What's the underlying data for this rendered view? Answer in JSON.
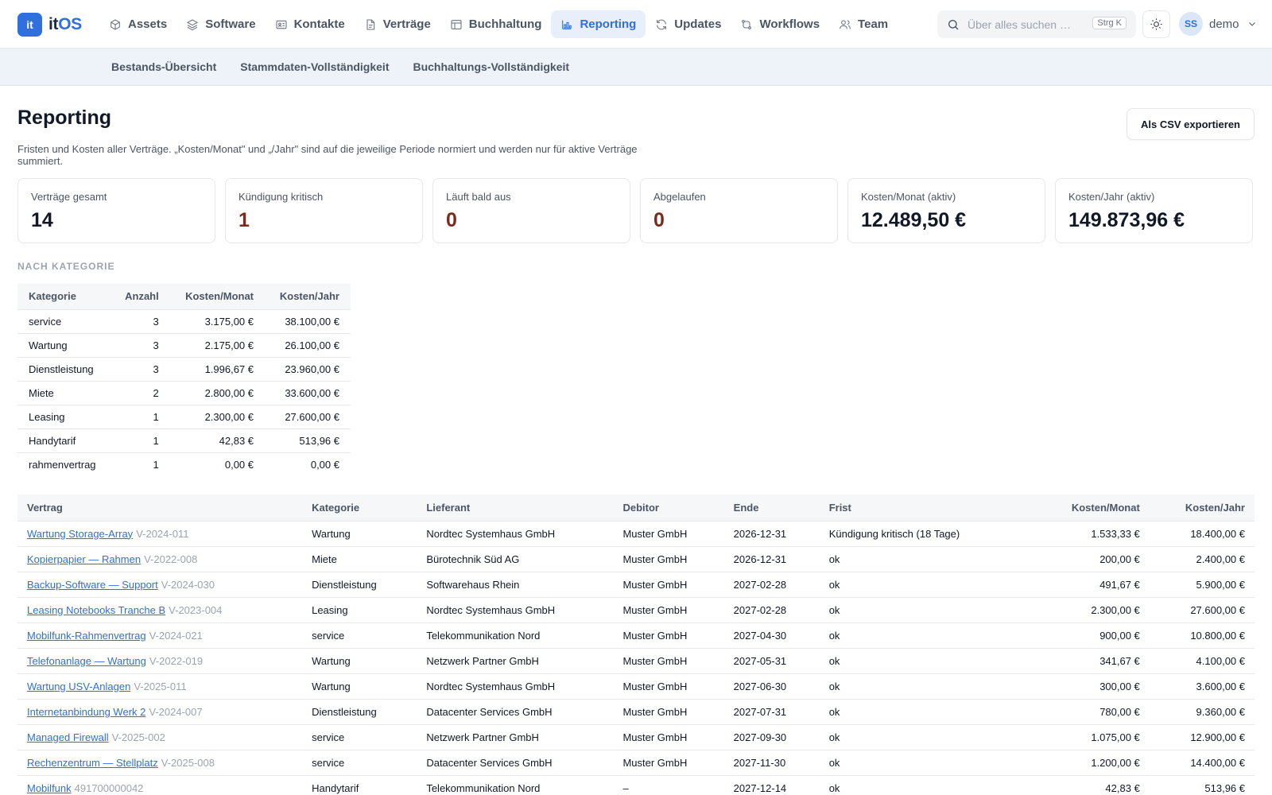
{
  "app": {
    "logo_badge": "it",
    "logo_prefix": "it",
    "logo_suffix": "OS"
  },
  "nav": [
    {
      "label": "Assets",
      "icon": "cube-icon",
      "active": false
    },
    {
      "label": "Software",
      "icon": "layers-icon",
      "active": false
    },
    {
      "label": "Kontakte",
      "icon": "contact-card-icon",
      "active": false
    },
    {
      "label": "Verträge",
      "icon": "document-icon",
      "active": false
    },
    {
      "label": "Buchhaltung",
      "icon": "ledger-icon",
      "active": false
    },
    {
      "label": "Reporting",
      "icon": "bar-chart-icon",
      "active": true
    },
    {
      "label": "Updates",
      "icon": "refresh-icon",
      "active": false
    },
    {
      "label": "Workflows",
      "icon": "workflow-icon",
      "active": false
    },
    {
      "label": "Team",
      "icon": "users-icon",
      "active": false
    }
  ],
  "search": {
    "placeholder": "Über alles suchen …",
    "shortcut": "Strg K"
  },
  "user": {
    "initials": "SS",
    "name": "demo"
  },
  "subnav": [
    "Bestands-Übersicht",
    "Stammdaten-Vollständigkeit",
    "Buchhaltungs-Vollständigkeit"
  ],
  "page": {
    "title": "Reporting",
    "description": "Fristen und Kosten aller Verträge. „Kosten/Monat\" und „/Jahr\" sind auf die jeweilige Periode normiert und werden nur für aktive Verträge summiert.",
    "export_label": "Als CSV exportieren"
  },
  "cards": [
    {
      "label": "Verträge gesamt",
      "value": "14",
      "warn": false
    },
    {
      "label": "Kündigung kritisch",
      "value": "1",
      "warn": true
    },
    {
      "label": "Läuft bald aus",
      "value": "0",
      "warn": true
    },
    {
      "label": "Abgelaufen",
      "value": "0",
      "warn": true
    },
    {
      "label": "Kosten/Monat (aktiv)",
      "value": "12.489,50 €",
      "warn": false
    },
    {
      "label": "Kosten/Jahr (aktiv)",
      "value": "149.873,96 €",
      "warn": false
    }
  ],
  "categories": {
    "title": "NACH KATEGORIE",
    "headers": [
      "Kategorie",
      "Anzahl",
      "Kosten/Monat",
      "Kosten/Jahr"
    ],
    "rows": [
      [
        "service",
        "3",
        "3.175,00 €",
        "38.100,00 €"
      ],
      [
        "Wartung",
        "3",
        "2.175,00 €",
        "26.100,00 €"
      ],
      [
        "Dienstleistung",
        "3",
        "1.996,67 €",
        "23.960,00 €"
      ],
      [
        "Miete",
        "2",
        "2.800,00 €",
        "33.600,00 €"
      ],
      [
        "Leasing",
        "1",
        "2.300,00 €",
        "27.600,00 €"
      ],
      [
        "Handytarif",
        "1",
        "42,83 €",
        "513,96 €"
      ],
      [
        "rahmenvertrag",
        "1",
        "0,00 €",
        "0,00 €"
      ]
    ]
  },
  "contracts": {
    "headers": [
      "Vertrag",
      "Kategorie",
      "Lieferant",
      "Debitor",
      "Ende",
      "Frist",
      "Kosten/Monat",
      "Kosten/Jahr"
    ],
    "rows": [
      {
        "name": "Wartung Storage-Array",
        "number": "V-2024-011",
        "category": "Wartung",
        "supplier": "Nordtec Systemhaus GmbH",
        "debtor": "Muster GmbH",
        "end": "2026-12-31",
        "deadline": "Kündigung kritisch (18 Tage)",
        "critical": true,
        "monthly": "1.533,33 €",
        "yearly": "18.400,00 €"
      },
      {
        "name": "Kopierpapier — Rahmen",
        "number": "V-2022-008",
        "category": "Miete",
        "supplier": "Bürotechnik Süd AG",
        "debtor": "Muster GmbH",
        "end": "2026-12-31",
        "deadline": "ok",
        "critical": false,
        "monthly": "200,00 €",
        "yearly": "2.400,00 €"
      },
      {
        "name": "Backup-Software — Support",
        "number": "V-2024-030",
        "category": "Dienstleistung",
        "supplier": "Softwarehaus Rhein",
        "debtor": "Muster GmbH",
        "end": "2027-02-28",
        "deadline": "ok",
        "critical": false,
        "monthly": "491,67 €",
        "yearly": "5.900,00 €"
      },
      {
        "name": "Leasing Notebooks Tranche B",
        "number": "V-2023-004",
        "category": "Leasing",
        "supplier": "Nordtec Systemhaus GmbH",
        "debtor": "Muster GmbH",
        "end": "2027-02-28",
        "deadline": "ok",
        "critical": false,
        "monthly": "2.300,00 €",
        "yearly": "27.600,00 €"
      },
      {
        "name": "Mobilfunk-Rahmenvertrag",
        "number": "V-2024-021",
        "category": "service",
        "supplier": "Telekommunikation Nord",
        "debtor": "Muster GmbH",
        "end": "2027-04-30",
        "deadline": "ok",
        "critical": false,
        "monthly": "900,00 €",
        "yearly": "10.800,00 €"
      },
      {
        "name": "Telefonanlage — Wartung",
        "number": "V-2022-019",
        "category": "Wartung",
        "supplier": "Netzwerk Partner GmbH",
        "debtor": "Muster GmbH",
        "end": "2027-05-31",
        "deadline": "ok",
        "critical": false,
        "monthly": "341,67 €",
        "yearly": "4.100,00 €"
      },
      {
        "name": "Wartung USV-Anlagen",
        "number": "V-2025-011",
        "category": "Wartung",
        "supplier": "Nordtec Systemhaus GmbH",
        "debtor": "Muster GmbH",
        "end": "2027-06-30",
        "deadline": "ok",
        "critical": false,
        "monthly": "300,00 €",
        "yearly": "3.600,00 €"
      },
      {
        "name": "Internetanbindung Werk 2",
        "number": "V-2024-007",
        "category": "Dienstleistung",
        "supplier": "Datacenter Services GmbH",
        "debtor": "Muster GmbH",
        "end": "2027-07-31",
        "deadline": "ok",
        "critical": false,
        "monthly": "780,00 €",
        "yearly": "9.360,00 €"
      },
      {
        "name": "Managed Firewall",
        "number": "V-2025-002",
        "category": "service",
        "supplier": "Netzwerk Partner GmbH",
        "debtor": "Muster GmbH",
        "end": "2027-09-30",
        "deadline": "ok",
        "critical": false,
        "monthly": "1.075,00 €",
        "yearly": "12.900,00 €"
      },
      {
        "name": "Rechenzentrum — Stellplatz",
        "number": "V-2025-008",
        "category": "service",
        "supplier": "Datacenter Services GmbH",
        "debtor": "Muster GmbH",
        "end": "2027-11-30",
        "deadline": "ok",
        "critical": false,
        "monthly": "1.200,00 €",
        "yearly": "14.400,00 €"
      },
      {
        "name": "Mobilfunk",
        "number": "491700000042",
        "category": "Handytarif",
        "supplier": "Telekommunikation Nord",
        "debtor": "–",
        "end": "2027-12-14",
        "deadline": "ok",
        "critical": false,
        "monthly": "42,83 €",
        "yearly": "513,96 €"
      }
    ]
  },
  "colors": {
    "accent": "#2f6fde",
    "warn": "#7b2b1e",
    "subnav_bg": "#eef2f9"
  }
}
